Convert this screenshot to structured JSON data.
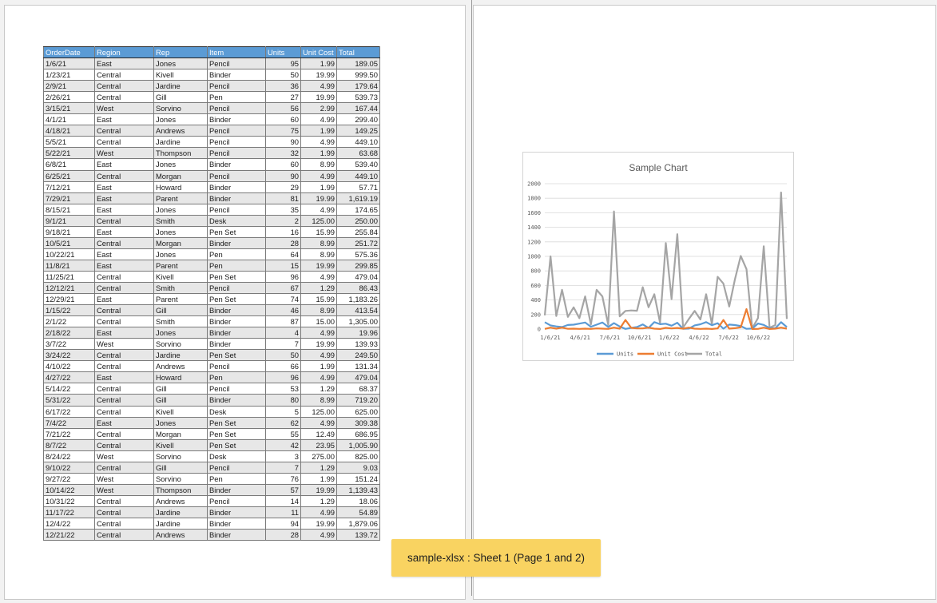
{
  "caption": "sample-xlsx : Sheet 1  (Page 1 and 2)",
  "table": {
    "headers": [
      "OrderDate",
      "Region",
      "Rep",
      "Item",
      "Units",
      "Unit Cost",
      "Total"
    ],
    "rows": [
      [
        "1/6/21",
        "East",
        "Jones",
        "Pencil",
        "95",
        "1.99",
        "189.05"
      ],
      [
        "1/23/21",
        "Central",
        "Kivell",
        "Binder",
        "50",
        "19.99",
        "999.50"
      ],
      [
        "2/9/21",
        "Central",
        "Jardine",
        "Pencil",
        "36",
        "4.99",
        "179.64"
      ],
      [
        "2/26/21",
        "Central",
        "Gill",
        "Pen",
        "27",
        "19.99",
        "539.73"
      ],
      [
        "3/15/21",
        "West",
        "Sorvino",
        "Pencil",
        "56",
        "2.99",
        "167.44"
      ],
      [
        "4/1/21",
        "East",
        "Jones",
        "Binder",
        "60",
        "4.99",
        "299.40"
      ],
      [
        "4/18/21",
        "Central",
        "Andrews",
        "Pencil",
        "75",
        "1.99",
        "149.25"
      ],
      [
        "5/5/21",
        "Central",
        "Jardine",
        "Pencil",
        "90",
        "4.99",
        "449.10"
      ],
      [
        "5/22/21",
        "West",
        "Thompson",
        "Pencil",
        "32",
        "1.99",
        "63.68"
      ],
      [
        "6/8/21",
        "East",
        "Jones",
        "Binder",
        "60",
        "8.99",
        "539.40"
      ],
      [
        "6/25/21",
        "Central",
        "Morgan",
        "Pencil",
        "90",
        "4.99",
        "449.10"
      ],
      [
        "7/12/21",
        "East",
        "Howard",
        "Binder",
        "29",
        "1.99",
        "57.71"
      ],
      [
        "7/29/21",
        "East",
        "Parent",
        "Binder",
        "81",
        "19.99",
        "1,619.19"
      ],
      [
        "8/15/21",
        "East",
        "Jones",
        "Pencil",
        "35",
        "4.99",
        "174.65"
      ],
      [
        "9/1/21",
        "Central",
        "Smith",
        "Desk",
        "2",
        "125.00",
        "250.00"
      ],
      [
        "9/18/21",
        "East",
        "Jones",
        "Pen Set",
        "16",
        "15.99",
        "255.84"
      ],
      [
        "10/5/21",
        "Central",
        "Morgan",
        "Binder",
        "28",
        "8.99",
        "251.72"
      ],
      [
        "10/22/21",
        "East",
        "Jones",
        "Pen",
        "64",
        "8.99",
        "575.36"
      ],
      [
        "11/8/21",
        "East",
        "Parent",
        "Pen",
        "15",
        "19.99",
        "299.85"
      ],
      [
        "11/25/21",
        "Central",
        "Kivell",
        "Pen Set",
        "96",
        "4.99",
        "479.04"
      ],
      [
        "12/12/21",
        "Central",
        "Smith",
        "Pencil",
        "67",
        "1.29",
        "86.43"
      ],
      [
        "12/29/21",
        "East",
        "Parent",
        "Pen Set",
        "74",
        "15.99",
        "1,183.26"
      ],
      [
        "1/15/22",
        "Central",
        "Gill",
        "Binder",
        "46",
        "8.99",
        "413.54"
      ],
      [
        "2/1/22",
        "Central",
        "Smith",
        "Binder",
        "87",
        "15.00",
        "1,305.00"
      ],
      [
        "2/18/22",
        "East",
        "Jones",
        "Binder",
        "4",
        "4.99",
        "19.96"
      ],
      [
        "3/7/22",
        "West",
        "Sorvino",
        "Binder",
        "7",
        "19.99",
        "139.93"
      ],
      [
        "3/24/22",
        "Central",
        "Jardine",
        "Pen Set",
        "50",
        "4.99",
        "249.50"
      ],
      [
        "4/10/22",
        "Central",
        "Andrews",
        "Pencil",
        "66",
        "1.99",
        "131.34"
      ],
      [
        "4/27/22",
        "East",
        "Howard",
        "Pen",
        "96",
        "4.99",
        "479.04"
      ],
      [
        "5/14/22",
        "Central",
        "Gill",
        "Pencil",
        "53",
        "1.29",
        "68.37"
      ],
      [
        "5/31/22",
        "Central",
        "Gill",
        "Binder",
        "80",
        "8.99",
        "719.20"
      ],
      [
        "6/17/22",
        "Central",
        "Kivell",
        "Desk",
        "5",
        "125.00",
        "625.00"
      ],
      [
        "7/4/22",
        "East",
        "Jones",
        "Pen Set",
        "62",
        "4.99",
        "309.38"
      ],
      [
        "7/21/22",
        "Central",
        "Morgan",
        "Pen Set",
        "55",
        "12.49",
        "686.95"
      ],
      [
        "8/7/22",
        "Central",
        "Kivell",
        "Pen Set",
        "42",
        "23.95",
        "1,005.90"
      ],
      [
        "8/24/22",
        "West",
        "Sorvino",
        "Desk",
        "3",
        "275.00",
        "825.00"
      ],
      [
        "9/10/22",
        "Central",
        "Gill",
        "Pencil",
        "7",
        "1.29",
        "9.03"
      ],
      [
        "9/27/22",
        "West",
        "Sorvino",
        "Pen",
        "76",
        "1.99",
        "151.24"
      ],
      [
        "10/14/22",
        "West",
        "Thompson",
        "Binder",
        "57",
        "19.99",
        "1,139.43"
      ],
      [
        "10/31/22",
        "Central",
        "Andrews",
        "Pencil",
        "14",
        "1.29",
        "18.06"
      ],
      [
        "11/17/22",
        "Central",
        "Jardine",
        "Binder",
        "11",
        "4.99",
        "54.89"
      ],
      [
        "12/4/22",
        "Central",
        "Jardine",
        "Binder",
        "94",
        "19.99",
        "1,879.06"
      ],
      [
        "12/21/22",
        "Central",
        "Andrews",
        "Binder",
        "28",
        "4.99",
        "139.72"
      ]
    ]
  },
  "chart_data": {
    "type": "line",
    "title": "Sample Chart",
    "ylim": [
      0,
      2000
    ],
    "yticks": [
      "0",
      "200",
      "400",
      "600",
      "800",
      "1000",
      "1200",
      "1400",
      "1600",
      "1800",
      "2000"
    ],
    "xtick_labels": [
      "1/6/21",
      "4/6/21",
      "7/6/21",
      "10/6/21",
      "1/6/22",
      "4/6/22",
      "7/6/22",
      "10/6/22"
    ],
    "x": [
      "1/6/21",
      "1/23/21",
      "2/9/21",
      "2/26/21",
      "3/15/21",
      "4/1/21",
      "4/18/21",
      "5/5/21",
      "5/22/21",
      "6/8/21",
      "6/25/21",
      "7/12/21",
      "7/29/21",
      "8/15/21",
      "9/1/21",
      "9/18/21",
      "10/5/21",
      "10/22/21",
      "11/8/21",
      "11/25/21",
      "12/12/21",
      "12/29/21",
      "1/15/22",
      "2/1/22",
      "2/18/22",
      "3/7/22",
      "3/24/22",
      "4/10/22",
      "4/27/22",
      "5/14/22",
      "5/31/22",
      "6/17/22",
      "7/4/22",
      "7/21/22",
      "8/7/22",
      "8/24/22",
      "9/10/22",
      "9/27/22",
      "10/14/22",
      "10/31/22",
      "11/17/22",
      "12/4/22",
      "12/21/22"
    ],
    "series": [
      {
        "name": "Units",
        "color": "#5b9bd5",
        "values": [
          95,
          50,
          36,
          27,
          56,
          60,
          75,
          90,
          32,
          60,
          90,
          29,
          81,
          35,
          2,
          16,
          28,
          64,
          15,
          96,
          67,
          74,
          46,
          87,
          4,
          7,
          50,
          66,
          96,
          53,
          80,
          5,
          62,
          55,
          42,
          3,
          7,
          76,
          57,
          14,
          11,
          94,
          28
        ]
      },
      {
        "name": "Unit Cost",
        "color": "#ed7d31",
        "values": [
          1.99,
          19.99,
          4.99,
          19.99,
          2.99,
          4.99,
          1.99,
          4.99,
          1.99,
          8.99,
          4.99,
          1.99,
          19.99,
          4.99,
          125,
          15.99,
          8.99,
          8.99,
          19.99,
          4.99,
          1.29,
          15.99,
          8.99,
          15,
          4.99,
          19.99,
          4.99,
          1.99,
          4.99,
          1.29,
          8.99,
          125,
          4.99,
          12.49,
          23.95,
          275,
          1.29,
          1.99,
          19.99,
          1.29,
          4.99,
          19.99,
          4.99
        ]
      },
      {
        "name": "Total",
        "color": "#a5a5a5",
        "values": [
          189.05,
          999.5,
          179.64,
          539.73,
          167.44,
          299.4,
          149.25,
          449.1,
          63.68,
          539.4,
          449.1,
          57.71,
          1619.19,
          174.65,
          250,
          255.84,
          251.72,
          575.36,
          299.85,
          479.04,
          86.43,
          1183.26,
          413.54,
          1305,
          19.96,
          139.93,
          249.5,
          131.34,
          479.04,
          68.37,
          719.2,
          625,
          309.38,
          686.95,
          1005.9,
          825,
          9.03,
          151.24,
          1139.43,
          18.06,
          54.89,
          1879.06,
          139.72
        ]
      }
    ],
    "legend_position": "bottom",
    "grid": true
  }
}
